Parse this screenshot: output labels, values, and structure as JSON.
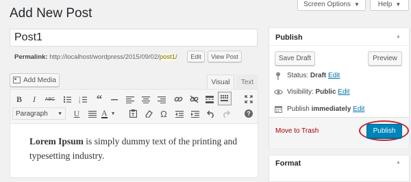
{
  "header": {
    "title": "Add New Post",
    "screen_options": "Screen Options",
    "help": "Help"
  },
  "post": {
    "title_value": "Post1",
    "permalink_label": "Permalink:",
    "permalink_base": "http://localhost/wordpress/2015/09/02/",
    "permalink_slug": "post1",
    "permalink_tail": "/",
    "edit_button": "Edit",
    "view_button": "View Post"
  },
  "editor": {
    "add_media": "Add Media",
    "tab_visual": "Visual",
    "tab_text": "Text",
    "format_select": "Paragraph",
    "content_bold": "Lorem Ipsum",
    "content_rest": " is simply dummy text of the printing and typesetting industry.",
    "toolbar_row1": [
      "bold-icon",
      "italic-icon",
      "strikethrough-icon",
      "bullet-list-icon",
      "numbered-list-icon",
      "blockquote-icon",
      "horizontal-line-icon",
      "align-left-icon",
      "align-center-icon",
      "align-right-icon",
      "insert-link-icon",
      "remove-link-icon",
      "read-more-icon",
      "toolbar-toggle-icon"
    ],
    "toolbar_row2": [
      "underline-icon",
      "justify-icon",
      "text-color-icon",
      "paste-text-icon",
      "clear-formatting-icon",
      "special-character-icon",
      "outdent-icon",
      "indent-icon",
      "undo-icon",
      "redo-icon",
      "help-icon"
    ]
  },
  "publish_box": {
    "title": "Publish",
    "save_draft": "Save Draft",
    "preview": "Preview",
    "status_label": "Status:",
    "status_value": "Draft",
    "visibility_label": "Visibility:",
    "visibility_value": "Public",
    "publish_label": "Publish",
    "publish_when": "immediately",
    "edit_link": "Edit",
    "move_to_trash": "Move to Trash",
    "publish_button": "Publish"
  },
  "format_box": {
    "title": "Format"
  },
  "colors": {
    "accent": "#0073aa",
    "publish_button": "#0085ba",
    "trash": "#a00",
    "highlight_ring": "#c0272d",
    "slug_highlight": "#fffbcc"
  }
}
